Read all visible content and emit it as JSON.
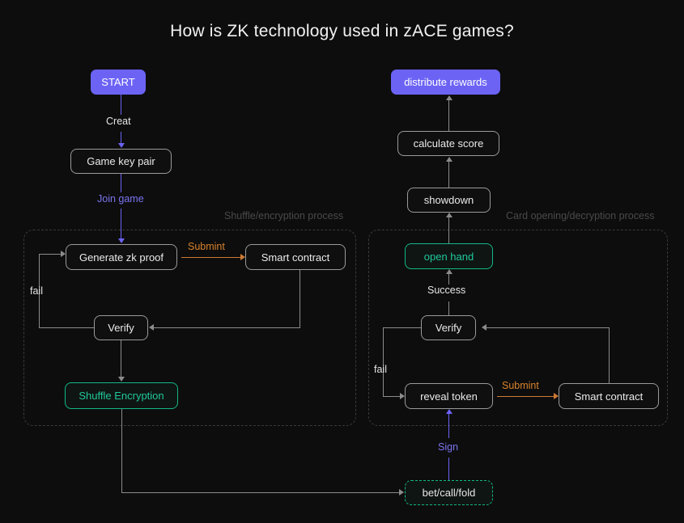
{
  "diagram": {
    "title": "How is ZK technology used in zACE games?",
    "background_color": "#0d0d0d",
    "accent_purple": "#6c63f5",
    "accent_green": "#12b886",
    "accent_orange": "#cf7a33",
    "line_color": "#8c8c8c",
    "group_label_color": "#4a4a4a"
  },
  "groups": [
    {
      "id": "shuffle",
      "label": "Shuffle/encryption process"
    },
    {
      "id": "card_opening",
      "label": "Card opening/decryption process"
    }
  ],
  "nodes": {
    "start": "START",
    "game_key_pair": "Game key pair",
    "generate_zk_proof": "Generate zk proof",
    "smart_contract_left": "Smart contract",
    "verify_left": "Verify",
    "shuffle_encryption": "Shuffle Encryption",
    "bet_call_fold": "bet/call/fold",
    "reveal_token": "reveal token",
    "smart_contract_right": "Smart contract",
    "verify_right": "Verify",
    "open_hand": "open hand",
    "showdown": "showdown",
    "calculate_score": "calculate score",
    "distribute_rewards": "distribute rewards"
  },
  "edge_labels": {
    "creat": "Creat",
    "join_game": "Join game",
    "submint_left": "Submint",
    "fail_left": "fail",
    "sign": "Sign",
    "submint_right": "Submint",
    "fail_right": "fail",
    "success": "Success"
  }
}
